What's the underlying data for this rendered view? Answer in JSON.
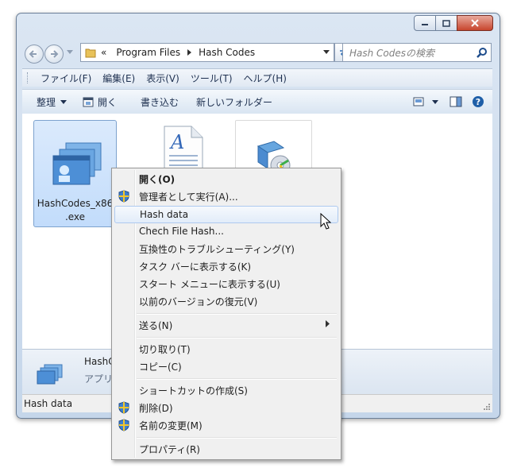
{
  "address": {
    "chevrons": "«",
    "crumbs": [
      "Program Files",
      "Hash Codes"
    ]
  },
  "search": {
    "placeholder": "Hash Codesの検索"
  },
  "menubar": [
    "ファイル(F)",
    "編集(E)",
    "表示(V)",
    "ツール(T)",
    "ヘルプ(H)"
  ],
  "commands": {
    "organize": "整理",
    "open": "開く",
    "burn": "書き込む",
    "new_folder": "新しいフォルダー"
  },
  "files": [
    {
      "name_line1": "HashCodes_x86",
      "name_line2": ".exe",
      "icon": "app-window-icon"
    },
    {
      "name_line1": "",
      "name_line2": "",
      "icon": "text-document-icon"
    },
    {
      "name_line1": "",
      "name_line2": "",
      "icon": "installer-icon"
    }
  ],
  "details": {
    "name": "HashC",
    "type": "アプリ"
  },
  "status": {
    "text": "Hash data"
  },
  "context_menu": {
    "items": [
      {
        "label": "開く(O)",
        "bold": true
      },
      {
        "label": "管理者として実行(A)...",
        "shield": true
      },
      {
        "label": "Hash data",
        "highlighted": true
      },
      {
        "label": "Chech File Hash..."
      },
      {
        "label": "互換性のトラブルシューティング(Y)"
      },
      {
        "label": "タスク バーに表示する(K)"
      },
      {
        "label": "スタート メニューに表示する(U)"
      },
      {
        "label": "以前のバージョンの復元(V)"
      },
      {
        "label": "送る(N)",
        "submenu": true
      },
      {
        "label": "切り取り(T)"
      },
      {
        "label": "コピー(C)"
      },
      {
        "label": "ショートカットの作成(S)"
      },
      {
        "label": "削除(D)",
        "shield": true
      },
      {
        "label": "名前の変更(M)",
        "shield": true
      },
      {
        "label": "プロパティ(R)"
      }
    ]
  },
  "colors": {
    "selection": "#c2dcfb",
    "menu_bg": "#f0f0f0",
    "highlight_border": "#aecaf0",
    "close_button": "#c7452d"
  }
}
